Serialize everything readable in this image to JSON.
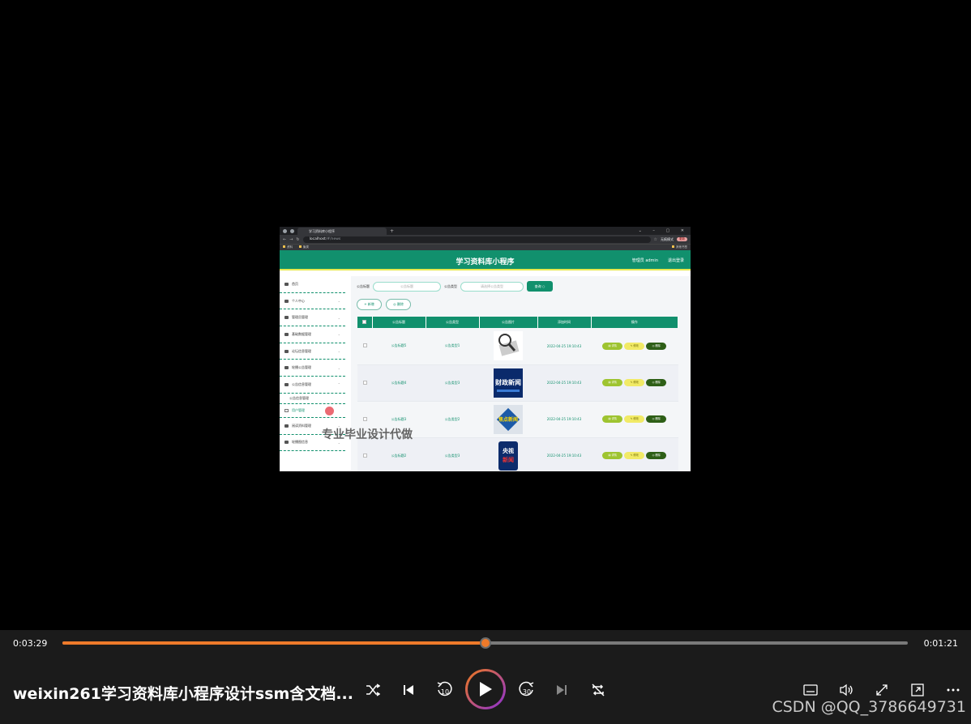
{
  "browser": {
    "tab_title": "学习资料库小程序",
    "url": "localhost",
    "url_rest": "/#/news",
    "incognito_label": "无痕模式",
    "error_label": "更新",
    "bookmarks": [
      "资料",
      "聚类"
    ],
    "bookmarks_right": "其他书签"
  },
  "app": {
    "title": "学习资料库小程序",
    "user_label": "管理员 admin",
    "logout_label": "退出登录"
  },
  "sidebar": {
    "items": [
      {
        "label": "首页"
      },
      {
        "label": "个人中心"
      },
      {
        "label": "管理员管理"
      },
      {
        "label": "基础数据管理"
      },
      {
        "label": "论坛信息管理"
      },
      {
        "label": "轮播公告管理"
      },
      {
        "label": "公告信息管理"
      }
    ],
    "subitems": [
      "公告信息管理",
      "用户管理"
    ],
    "items_after": [
      {
        "label": "阅读资料管理"
      },
      {
        "label": "轮播图信息"
      }
    ]
  },
  "filters": {
    "title_label": "公告标题",
    "title_placeholder": "公告标题",
    "type_label": "公告类型",
    "type_placeholder": "请选择公告类型",
    "query_label": "查询 ○"
  },
  "actions": {
    "add_label": "+ 新增",
    "delete_label": "◎ 删除"
  },
  "table": {
    "headers": [
      "公告标题",
      "公告类型",
      "公告图片",
      "添加时间",
      "操作"
    ],
    "view_label": "▤ 详情",
    "edit_label": "✎ 修改",
    "delete_label": "◎ 删除",
    "rows": [
      {
        "title": "公告标题5",
        "type": "公告类型1",
        "image": "magnifier-icon",
        "time": "2022-04-25 19:10:43"
      },
      {
        "title": "公告标题4",
        "type": "公告类型3",
        "image": "finance-news-thumb",
        "time": "2022-04-25 19:10:43"
      },
      {
        "title": "公告标题3",
        "type": "公告类型2",
        "image": "focus-news-thumb",
        "time": "2022-04-25 19:10:43"
      },
      {
        "title": "公告标题2",
        "type": "公告类型3",
        "image": "cctv-news-thumb",
        "time": "2022-04-25 19:10:43"
      }
    ],
    "thumb_texts": {
      "finance": "财政新闻",
      "focus": "焦点新闻",
      "cctv_top": "央视",
      "cctv_bottom": "新闻"
    }
  },
  "watermark": "专业毕业设计代做",
  "player": {
    "elapsed": "0:03:29",
    "remaining": "0:01:21",
    "progress_fraction": 0.5,
    "title": "weixin261学习资料库小程序设计ssm含文档...",
    "brand": "CSDN @QQ_3786649731"
  },
  "colors": {
    "app_green": "#11906d",
    "accent_orange": "#ee7a2a"
  }
}
